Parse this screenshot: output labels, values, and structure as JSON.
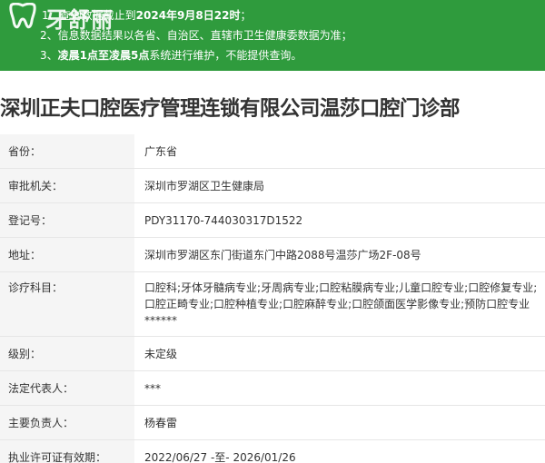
{
  "notice": {
    "line1_prefix": "1、查询数据截止到",
    "line1_bold": "2024年9月8日22时",
    "line1_suffix": "；",
    "line2": "2、信息数据结果以各省、自治区、直辖市卫生健康委数据为准；",
    "line3_prefix": "3、",
    "line3_bold": "凌晨1点至凌晨5点",
    "line3_suffix": "系统进行维护，不能提供查询。",
    "background_color": "#2f9b3d"
  },
  "logo": {
    "text": "牙舒丽",
    "icon": "tooth-icon"
  },
  "page": {
    "title": "深圳正夫口腔医疗管理连锁有限公司温莎口腔门诊部"
  },
  "info": {
    "rows": [
      {
        "label": "省份：",
        "value": "广东省"
      },
      {
        "label": "审批机关：",
        "value": "深圳市罗湖区卫生健康局"
      },
      {
        "label": "登记号：",
        "value": "PDY31170-744030317D1522"
      },
      {
        "label": "地址：",
        "value": "深圳市罗湖区东门街道东门中路2088号温莎广场2F-08号"
      },
      {
        "label": "诊疗科目：",
        "value": "口腔科;牙体牙髓病专业;牙周病专业;口腔粘膜病专业;儿童口腔专业;口腔修复专业;口腔正畸专业;口腔种植专业;口腔麻醉专业;口腔颌面医学影像专业;预防口腔专业******"
      },
      {
        "label": "级别：",
        "value": "未定级"
      },
      {
        "label": "法定代表人：",
        "value": "***"
      },
      {
        "label": "主要负责人：",
        "value": "杨春雷"
      },
      {
        "label": "执业许可证有效期：",
        "value": "2022/06/27 -至- 2026/01/26"
      }
    ]
  }
}
